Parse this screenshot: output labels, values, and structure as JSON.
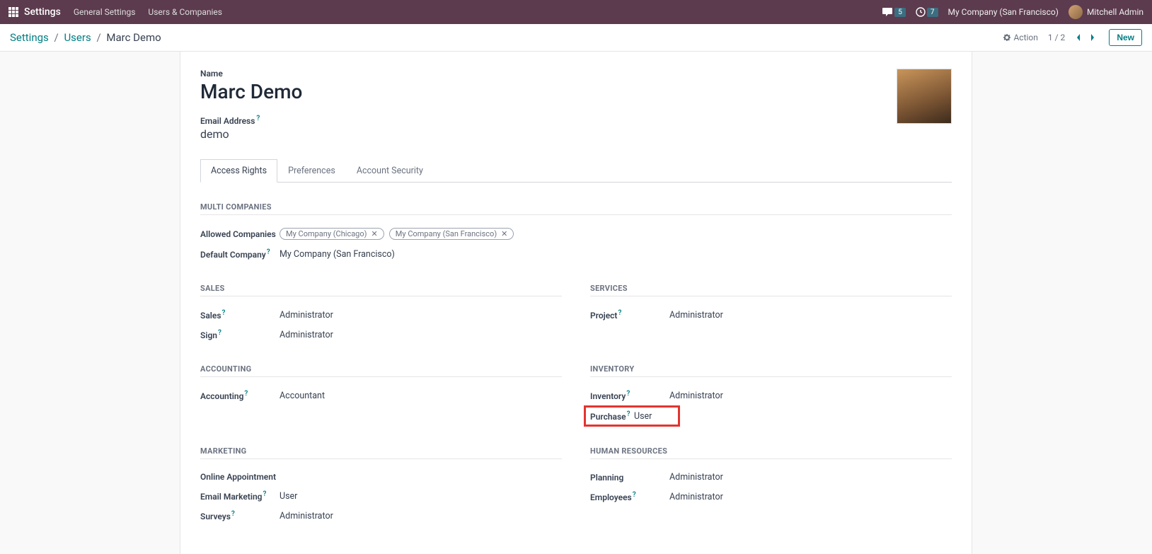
{
  "topbar": {
    "module": "Settings",
    "menu": [
      "General Settings",
      "Users & Companies"
    ],
    "chat_count": "5",
    "clock_count": "7",
    "company": "My Company (San Francisco)",
    "user": "Mitchell Admin"
  },
  "breadcrumb": {
    "root": "Settings",
    "parent": "Users",
    "current": "Marc Demo"
  },
  "actions": {
    "action_label": "Action",
    "pager": "1 / 2",
    "new_label": "New"
  },
  "form": {
    "name_label": "Name",
    "name_value": "Marc Demo",
    "email_label": "Email Address",
    "email_value": "demo",
    "tabs": [
      "Access Rights",
      "Preferences",
      "Account Security"
    ],
    "multi_companies": {
      "title": "MULTI COMPANIES",
      "allowed_label": "Allowed Companies",
      "allowed": [
        "My Company (Chicago)",
        "My Company (San Francisco)"
      ],
      "default_label": "Default Company",
      "default_value": "My Company (San Francisco)"
    },
    "sales": {
      "title": "SALES",
      "rows": [
        {
          "label": "Sales",
          "q": true,
          "value": "Administrator"
        },
        {
          "label": "Sign",
          "q": true,
          "value": "Administrator"
        }
      ]
    },
    "services": {
      "title": "SERVICES",
      "rows": [
        {
          "label": "Project",
          "q": true,
          "value": "Administrator"
        }
      ]
    },
    "accounting": {
      "title": "ACCOUNTING",
      "rows": [
        {
          "label": "Accounting",
          "q": true,
          "value": "Accountant"
        }
      ]
    },
    "inventory": {
      "title": "INVENTORY",
      "rows": [
        {
          "label": "Inventory",
          "q": true,
          "value": "Administrator"
        },
        {
          "label": "Purchase",
          "q": true,
          "value": "User",
          "highlight": true
        }
      ]
    },
    "marketing": {
      "title": "MARKETING",
      "rows": [
        {
          "label": "Online Appointment",
          "q": false,
          "value": ""
        },
        {
          "label": "Email Marketing",
          "q": true,
          "value": "User"
        },
        {
          "label": "Surveys",
          "q": true,
          "value": "Administrator"
        }
      ]
    },
    "hr": {
      "title": "HUMAN RESOURCES",
      "rows": [
        {
          "label": "Planning",
          "q": false,
          "value": "Administrator"
        },
        {
          "label": "Employees",
          "q": true,
          "value": "Administrator"
        }
      ]
    }
  }
}
